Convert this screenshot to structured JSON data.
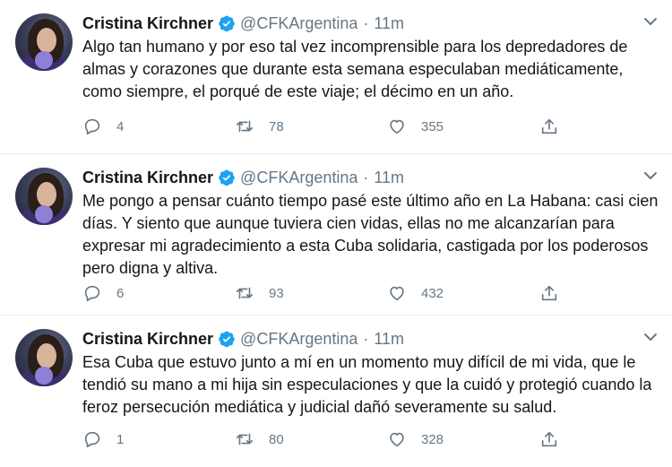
{
  "tweets": [
    {
      "author": "Cristina Kirchner",
      "handle": "@CFKArgentina",
      "separator": "·",
      "time": "11m",
      "text": "Algo tan humano y por eso tal vez incomprensible para los depredadores de almas y corazones que durante esta semana especulaban mediáticamente, como siempre, el porqué de este viaje; el décimo en un año.",
      "replies": "4",
      "retweets": "78",
      "likes": "355"
    },
    {
      "author": "Cristina Kirchner",
      "handle": "@CFKArgentina",
      "separator": "·",
      "time": "11m",
      "text": "Me pongo a pensar cuánto tiempo pasé este último año en La Habana: casi cien días. Y siento que aunque tuviera cien vidas, ellas no me alcanzarían para expresar mi agradecimiento a esta Cuba solidaria, castigada por los poderosos pero digna y altiva.",
      "replies": "6",
      "retweets": "93",
      "likes": "432"
    },
    {
      "author": "Cristina Kirchner",
      "handle": "@CFKArgentina",
      "separator": "·",
      "time": "11m",
      "text": "Esa Cuba que estuvo junto a mí en un momento muy difícil de mi vida, que le tendió su mano a mi hija sin especulaciones y que la cuidó y protegió cuando la feroz persecución mediática y judicial dañó severamente su salud.",
      "replies": "1",
      "retweets": "80",
      "likes": "328"
    }
  ],
  "icons": {
    "verified": "verified-badge-icon",
    "menu": "chevron-down-icon",
    "reply": "reply-icon",
    "retweet": "retweet-icon",
    "like": "heart-icon",
    "share": "share-icon"
  },
  "colors": {
    "accent": "#1da1f2",
    "text": "#14171a",
    "muted": "#657786",
    "divider": "#e6ecf0"
  }
}
